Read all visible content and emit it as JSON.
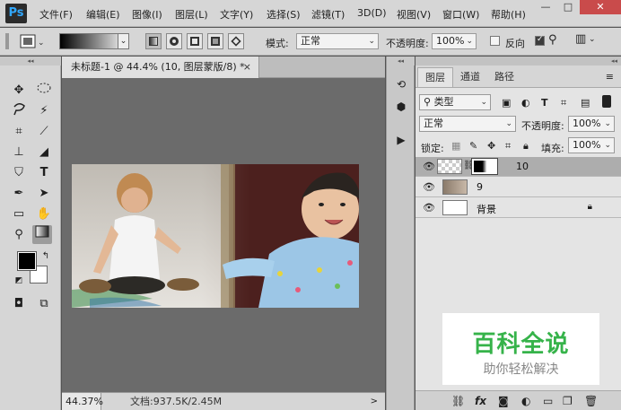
{
  "app": {
    "logo": "Ps"
  },
  "menu": [
    "文件(F)",
    "编辑(E)",
    "图像(I)",
    "图层(L)",
    "文字(Y)",
    "选择(S)",
    "滤镜(T)",
    "3D(D)",
    "视图(V)",
    "窗口(W)",
    "帮助(H)"
  ],
  "window_controls": {
    "minimize": "—",
    "maximize": "□",
    "close": "✕"
  },
  "options": {
    "mode_label": "模式:",
    "mode_value": "正常",
    "opacity_label": "不透明度:",
    "opacity_value": "100%",
    "reverse_label": "反向"
  },
  "document": {
    "tab_title": "未标题-1 @ 44.4% (10, 图层蒙版/8) *",
    "tab_close": "×",
    "zoom": "44.37%",
    "doc_size": "文档:937.5K/2.45M",
    "status_arrow": ">"
  },
  "panel_collapse": "◂◂",
  "layers_panel": {
    "tabs": [
      "图层",
      "通道",
      "路径"
    ],
    "filter_label": "类型",
    "blend_mode": "正常",
    "opacity_label": "不透明度:",
    "opacity_value": "100%",
    "lock_label": "锁定:",
    "fill_label": "填充:",
    "fill_value": "100%",
    "layers": [
      {
        "name": "10",
        "selected": true
      },
      {
        "name": "9",
        "selected": false
      },
      {
        "name": "背景",
        "selected": false
      }
    ]
  },
  "watermark": {
    "title": "百科全说",
    "subtitle": "助你轻松解决"
  }
}
